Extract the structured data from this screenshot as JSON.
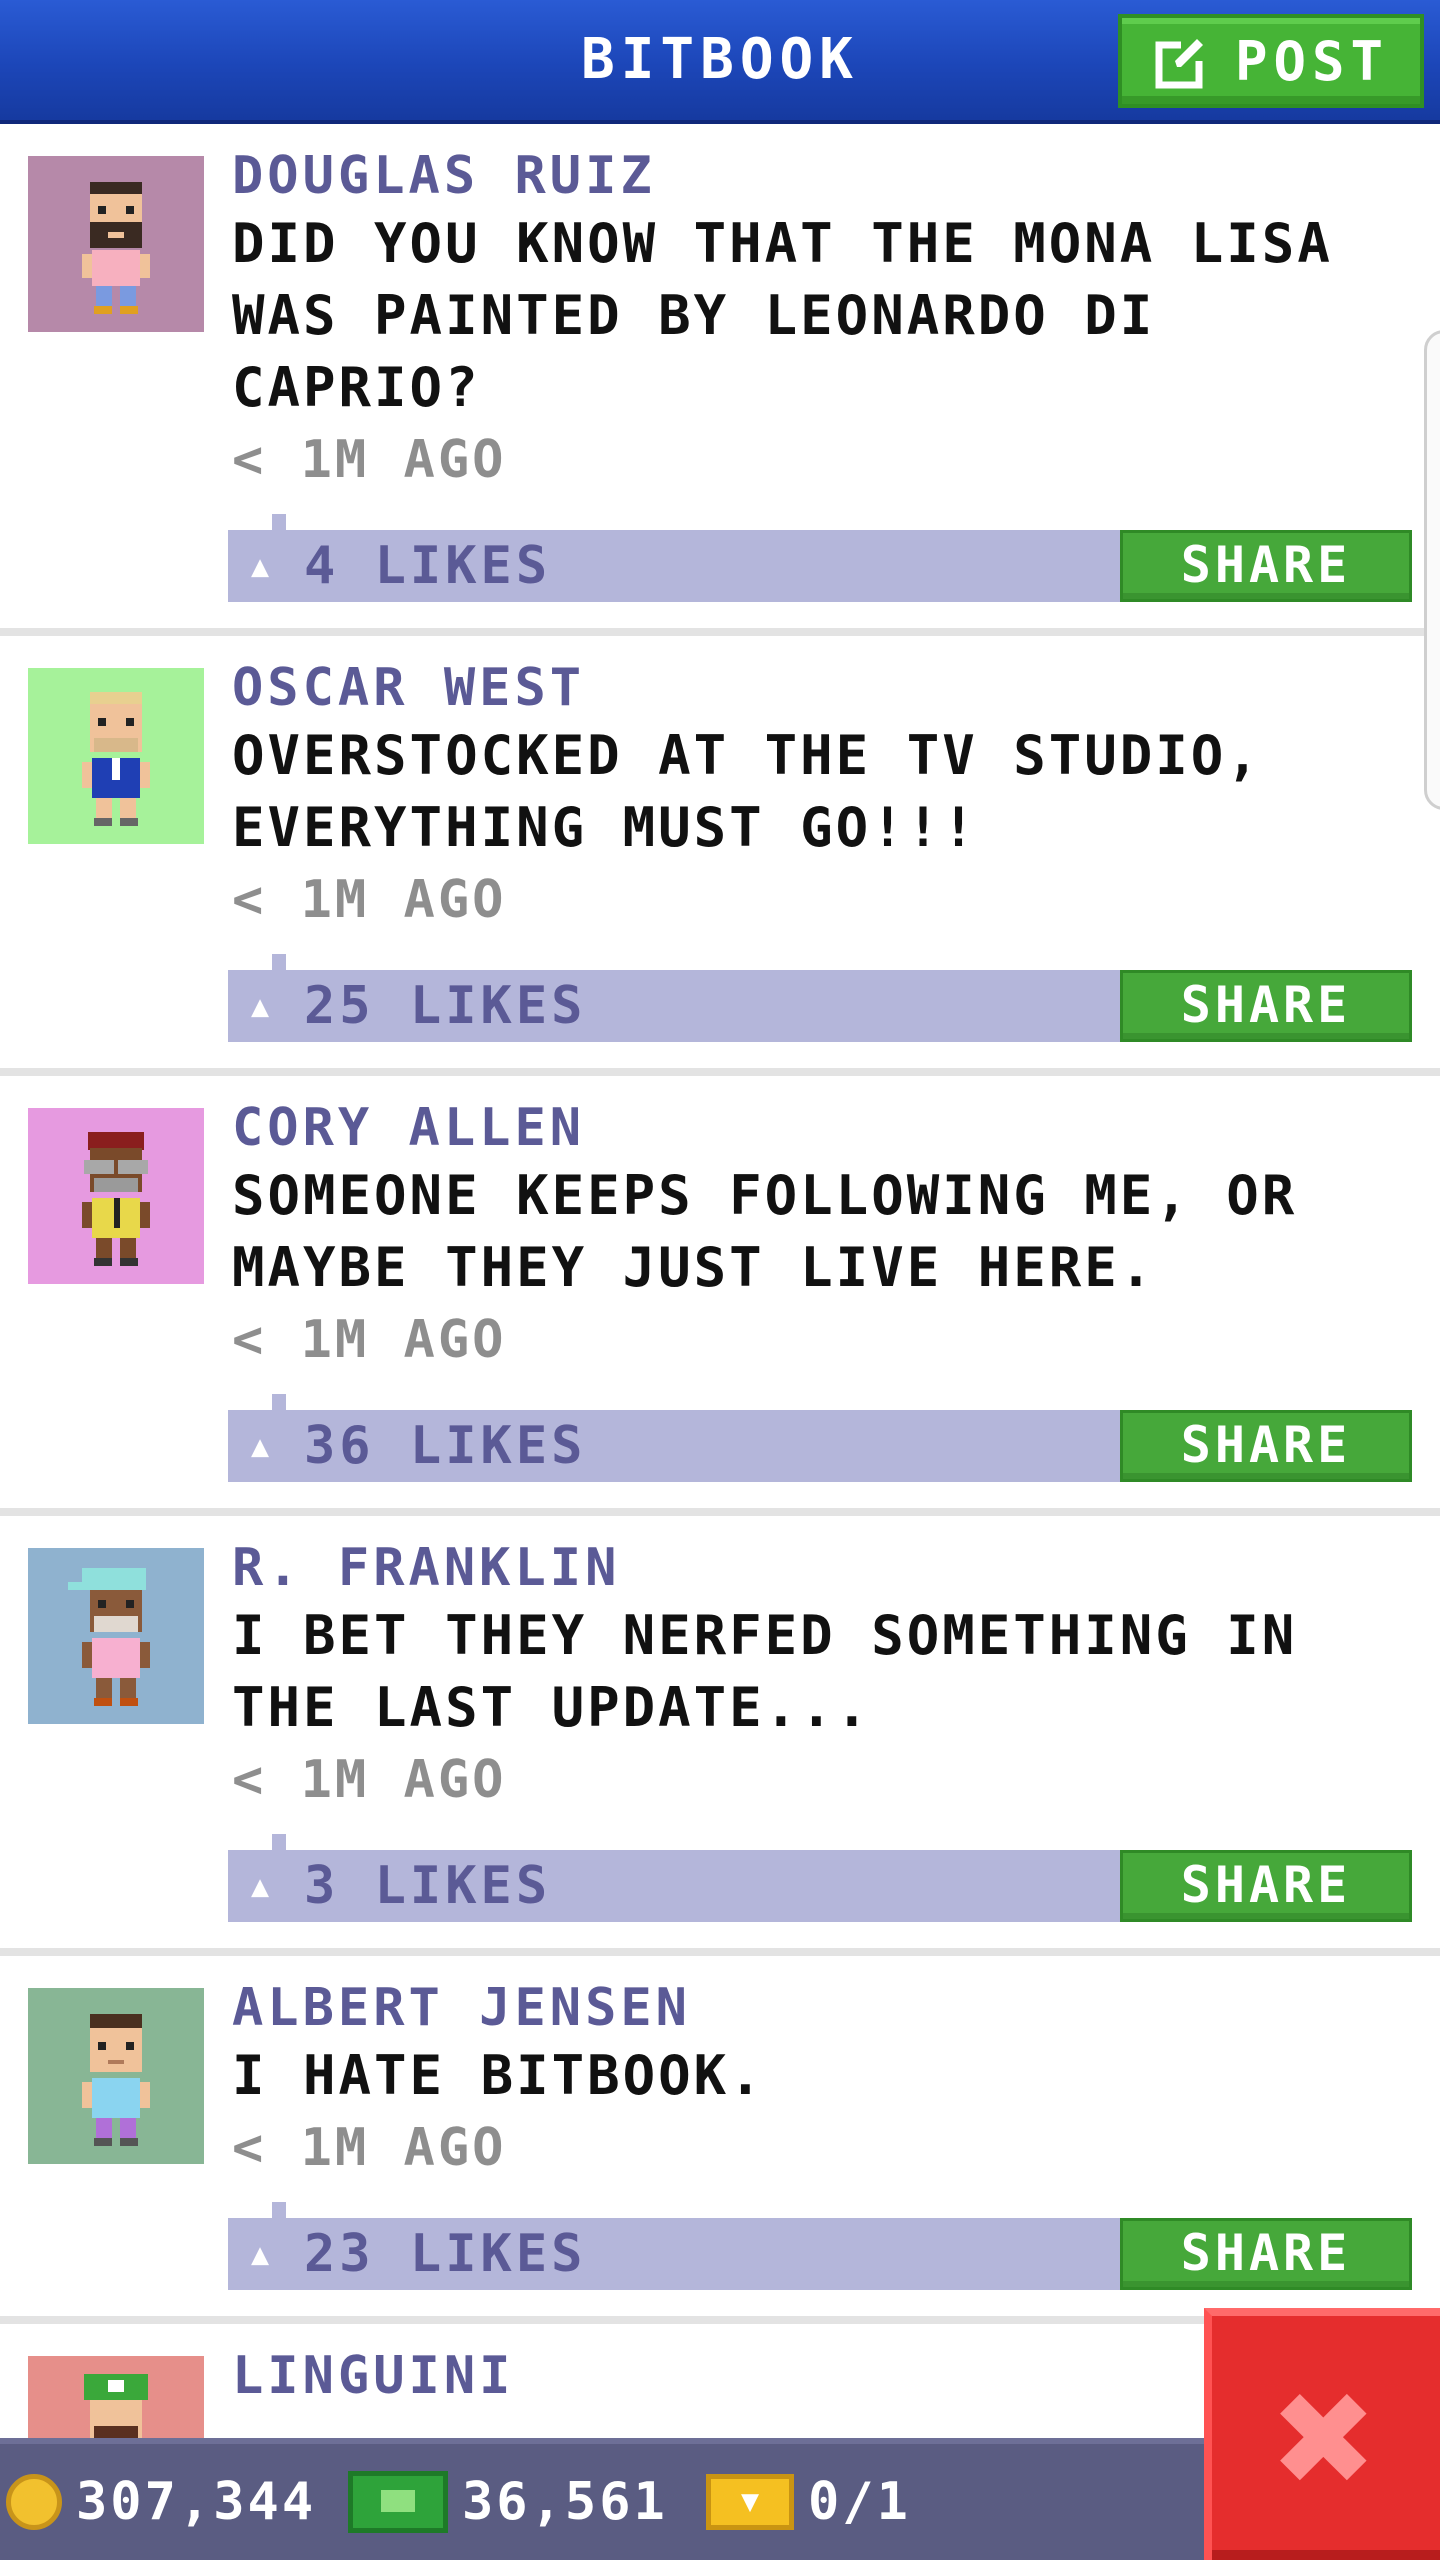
{
  "header": {
    "title": "BITBOOK",
    "post_label": "POST"
  },
  "posts": [
    {
      "author": "DOUGLAS RUIZ",
      "message": "DID YOU KNOW THAT THE MONA LISA WAS PAINTED BY LEONARDO DI CAPRIO?",
      "time": "< 1M AGO",
      "likes": "4 LIKES",
      "share": "SHARE",
      "avatar_bg": "#b689a9"
    },
    {
      "author": "OSCAR WEST",
      "message": "OVERSTOCKED AT THE TV STUDIO, EVERYTHING MUST GO!!!",
      "time": "< 1M AGO",
      "likes": "25 LIKES",
      "share": "SHARE",
      "avatar_bg": "#a6f29a"
    },
    {
      "author": "CORY ALLEN",
      "message": "SOMEONE KEEPS FOLLOWING ME, OR MAYBE THEY JUST LIVE HERE.",
      "time": "< 1M AGO",
      "likes": "36 LIKES",
      "share": "SHARE",
      "avatar_bg": "#e69ae0"
    },
    {
      "author": "R. FRANKLIN",
      "message": "I BET THEY NERFED SOMETHING IN THE LAST UPDATE...",
      "time": "< 1M AGO",
      "likes": "3 LIKES",
      "share": "SHARE",
      "avatar_bg": "#8fb2cf"
    },
    {
      "author": "ALBERT JENSEN",
      "message": "I HATE BITBOOK.",
      "time": "< 1M AGO",
      "likes": "23 LIKES",
      "share": "SHARE",
      "avatar_bg": "#88b695"
    },
    {
      "author": "LINGUINI",
      "avatar_bg": "#e68f8a"
    }
  ],
  "footer": {
    "coins": "307,344",
    "bux": "36,561",
    "tickets": "0/1"
  },
  "colors": {
    "header_blue": "#1c46b8",
    "author_purple": "#5b5a96",
    "action_bar": "#b4b6da",
    "share_green": "#46a83a",
    "close_red": "#e52d2d"
  }
}
